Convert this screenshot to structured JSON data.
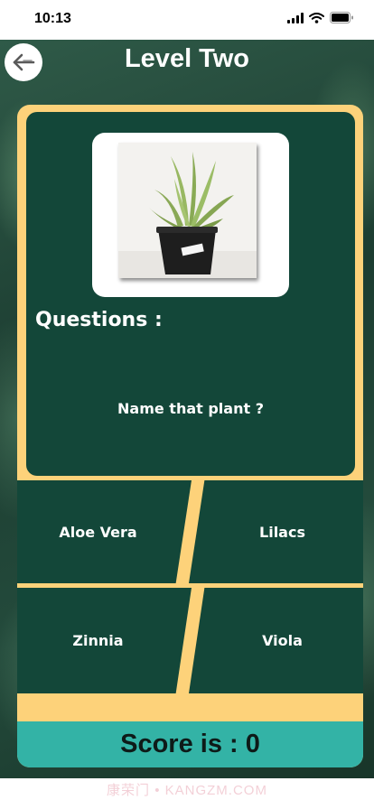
{
  "status_bar": {
    "time": "10:13"
  },
  "header": {
    "title": "Level Two"
  },
  "question_card": {
    "questions_label": "Questions :",
    "question": "Name that plant ?"
  },
  "answers": [
    {
      "label": "Aloe Vera"
    },
    {
      "label": "Lilacs"
    },
    {
      "label": "Zinnia"
    },
    {
      "label": "Viola"
    }
  ],
  "score": {
    "label": "Score is : 0"
  },
  "watermark": "康荣门 • KANGZM.COM",
  "colors": {
    "card_green": "#134739",
    "frame_yellow": "#fdd27a",
    "score_teal": "#33b3a6"
  }
}
